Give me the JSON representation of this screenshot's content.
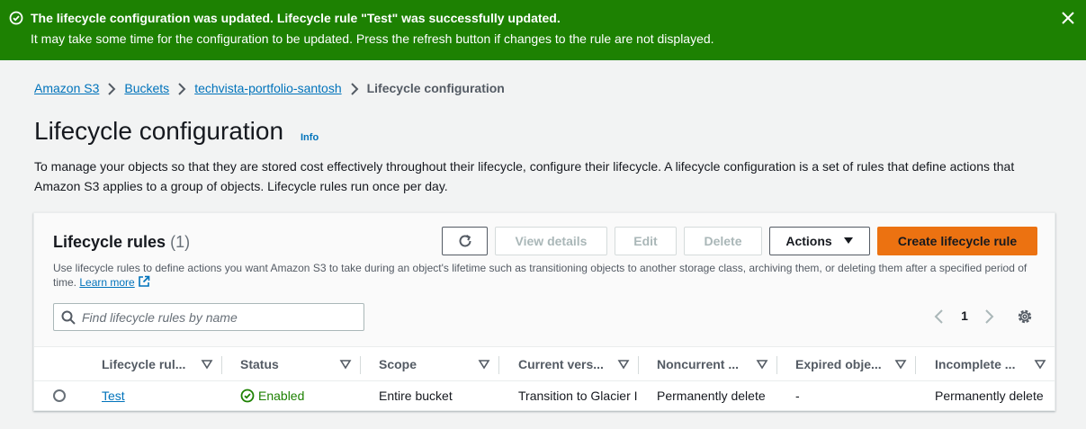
{
  "flash": {
    "title": "The lifecycle configuration was updated. Lifecycle rule \"Test\" was successfully updated.",
    "message": "It may take some time for the configuration to be updated. Press the refresh button if changes to the rule are not displayed.",
    "color": "#1d8102"
  },
  "breadcrumb": {
    "items": [
      "Amazon S3",
      "Buckets",
      "techvista-portfolio-santosh"
    ],
    "current": "Lifecycle configuration"
  },
  "header": {
    "title": "Lifecycle configuration",
    "info": "Info",
    "description": "To manage your objects so that they are stored cost effectively throughout their lifecycle, configure their lifecycle. A lifecycle configuration is a set of rules that define actions that Amazon S3 applies to a group of objects. Lifecycle rules run once per day."
  },
  "rules": {
    "title": "Lifecycle rules",
    "count": "(1)",
    "description": "Use lifecycle rules to define actions you want Amazon S3 to take during an object's lifetime such as transitioning objects to another storage class, archiving them, or deleting them after a specified period of time.",
    "learn_more": "Learn more",
    "buttons": {
      "view_details": "View details",
      "edit": "Edit",
      "delete": "Delete",
      "actions": "Actions",
      "create": "Create lifecycle rule"
    },
    "search": {
      "placeholder": "Find lifecycle rules by name",
      "value": ""
    },
    "pagination": {
      "current_page": "1"
    },
    "columns": [
      "Lifecycle rul...",
      "Status",
      "Scope",
      "Current vers...",
      "Noncurrent ...",
      "Expired obje...",
      "Incomplete ..."
    ],
    "rows": [
      {
        "name": "Test",
        "status": "Enabled",
        "scope": "Entire bucket",
        "current_version": "Transition to Glacier I",
        "noncurrent": "Permanently delete",
        "expired": "-",
        "incomplete": "Permanently delete"
      }
    ]
  },
  "icons": {
    "success": "success-check-icon",
    "close": "close-icon",
    "chevron": "chevron-right-icon",
    "external": "external-link-icon",
    "refresh": "refresh-icon",
    "caret": "caret-down-icon",
    "search": "search-icon",
    "settings": "gear-icon",
    "sort": "sort-caret-icon"
  },
  "colors": {
    "accent": "#ec7211",
    "link": "#0073bb",
    "success": "#1d8102"
  }
}
